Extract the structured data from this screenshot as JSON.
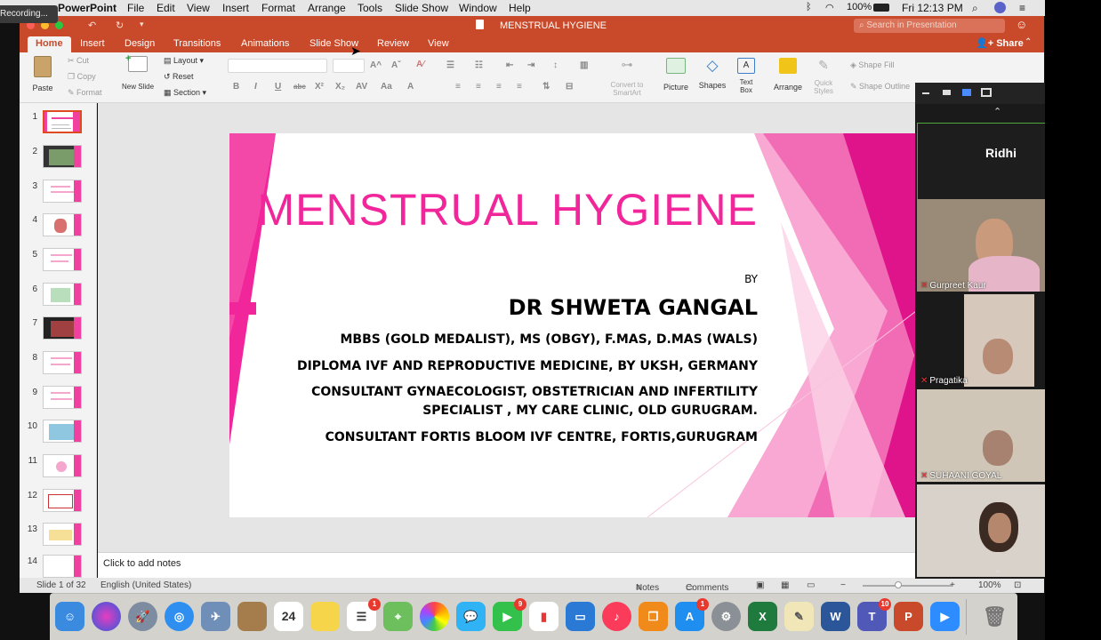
{
  "recording_label": "Recording...",
  "menubar": {
    "apple": "",
    "app": "PowerPoint",
    "items": [
      "File",
      "Edit",
      "View",
      "Insert",
      "Format",
      "Arrange",
      "Tools",
      "Slide Show",
      "Window",
      "Help"
    ],
    "battery": "100%",
    "clock": "Fri 12:13 PM"
  },
  "window": {
    "title": "MENSTRUAL HYGIENE",
    "search_placeholder": "Search in Presentation"
  },
  "tabs": [
    "Home",
    "Insert",
    "Design",
    "Transitions",
    "Animations",
    "Slide Show",
    "Review",
    "View"
  ],
  "share_label": "Share",
  "ribbon": {
    "paste": "Paste",
    "cut": "Cut",
    "copy": "Copy",
    "format": "Format",
    "new_slide": "New Slide",
    "layout": "Layout",
    "reset": "Reset",
    "section": "Section",
    "convert": "Convert to SmartArt",
    "picture": "Picture",
    "shapes": "Shapes",
    "text_box": "Text Box",
    "arrange": "Arrange",
    "quick_styles": "Quick Styles",
    "shape_fill": "Shape Fill",
    "shape_outline": "Shape Outline"
  },
  "thumbnails": [
    "1",
    "2",
    "3",
    "4",
    "5",
    "6",
    "7",
    "8",
    "9",
    "10",
    "11",
    "12",
    "13",
    "14"
  ],
  "slide": {
    "title": "MENSTRUAL HYGIENE",
    "by": "BY",
    "author": "DR SHWETA GANGAL",
    "lines": [
      "MBBS (GOLD MEDALIST), MS (OBGY), F.MAS, D.MAS (WALS)",
      "DIPLOMA IVF AND REPRODUCTIVE MEDICINE, BY UKSH, GERMANY",
      "CONSULTANT GYNAECOLOGIST, OBSTETRICIAN AND INFERTILITY",
      "SPECIALIST , MY CARE CLINIC, OLD GURUGRAM.",
      "CONSULTANT FORTIS BLOOM IVF CENTRE, FORTIS,GURUGRAM"
    ]
  },
  "notes_placeholder": "Click to add notes",
  "status": {
    "slide_of": "Slide 1 of 32",
    "language": "English (United States)",
    "notes": "Notes",
    "comments": "Comments",
    "zoom": "100%"
  },
  "participants": [
    {
      "name": "Ridhi"
    },
    {
      "name": "Gurpreet Kaur"
    },
    {
      "name": "Pragatika"
    },
    {
      "name": "SUHAANI GOYAL"
    },
    {
      "name": ""
    }
  ],
  "dock_badges": {
    "reminders": "1",
    "facetime": "9",
    "appstore": "1",
    "teams": "10"
  },
  "calendar_day": "24",
  "colors": {
    "accent": "#c94a2a",
    "slide_pink": "#f0269a"
  }
}
